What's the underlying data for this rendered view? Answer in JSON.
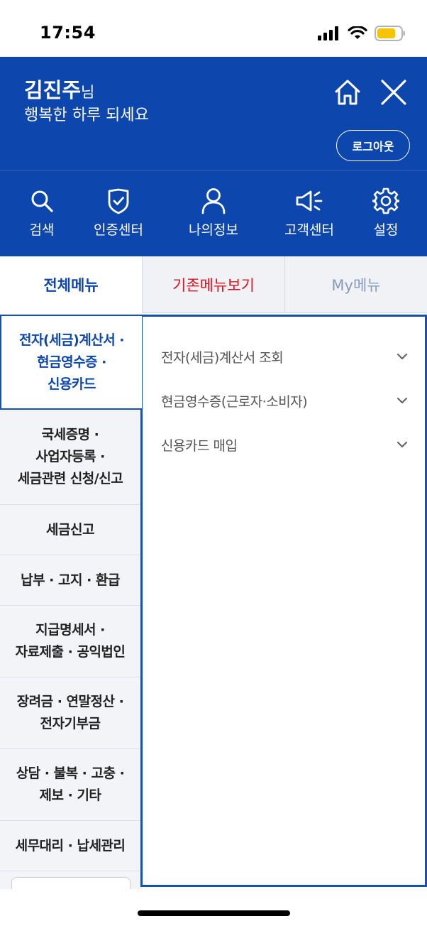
{
  "status_bar": {
    "time": "17:54"
  },
  "header": {
    "user_name": "김진주",
    "user_suffix": "님",
    "greeting": "행복한 하루 되세요",
    "logout_label": "로그아웃"
  },
  "quick_menu": [
    {
      "label": "검색",
      "icon": "search-icon"
    },
    {
      "label": "인증센터",
      "icon": "shield-check-icon"
    },
    {
      "label": "나의정보",
      "icon": "user-icon"
    },
    {
      "label": "고객센터",
      "icon": "megaphone-icon"
    },
    {
      "label": "설정",
      "icon": "gear-icon"
    }
  ],
  "tabs": {
    "all": "전체메뉴",
    "classic": "기존메뉴보기",
    "my": "My메뉴"
  },
  "categories": [
    {
      "lines": [
        "전자(세금)계산서 ·",
        "현금영수증 ·",
        "신용카드"
      ],
      "active": true
    },
    {
      "lines": [
        "국세증명 ·",
        "사업자등록 ·",
        "세금관련 신청/신고"
      ],
      "active": false
    },
    {
      "lines": [
        "세금신고"
      ],
      "active": false
    },
    {
      "lines": [
        "납부 · 고지 · 환급"
      ],
      "active": false
    },
    {
      "lines": [
        "지급명세서 ·",
        "자료제출 · 공익법인"
      ],
      "active": false
    },
    {
      "lines": [
        "장려금 · 연말정산 ·",
        "전자기부금"
      ],
      "active": false
    },
    {
      "lines": [
        "상담 · 불복 · 고충 ·",
        "제보 · 기타"
      ],
      "active": false
    },
    {
      "lines": [
        "세무대리 · 납세관리"
      ],
      "active": false
    }
  ],
  "sub_items": [
    {
      "label": "전자(세금)계산서 조회",
      "icon": "chevron-down-icon"
    },
    {
      "label": "현금영수증(근로자·소비자)",
      "icon": "chevron-down-icon"
    },
    {
      "label": "신용카드 매입",
      "icon": "chevron-down-icon"
    }
  ],
  "colors": {
    "brand_blue": "#0d47ae",
    "accent_red": "#e0101f",
    "muted": "#8a9bb8"
  }
}
